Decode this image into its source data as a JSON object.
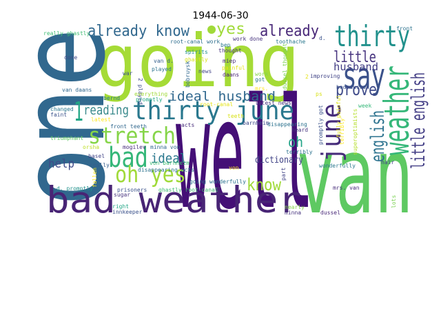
{
  "title": "1944-06-30",
  "words": [
    "going",
    "one",
    "well",
    "van",
    "bad weather",
    "thirty june",
    "thirty",
    "say",
    "weather",
    "little english",
    "english",
    "june",
    "already know",
    "yes",
    "already",
    "little",
    "husband",
    "ideal husband",
    "prove",
    "1",
    "reading",
    "stretch",
    "bad",
    "ideal",
    "oh yes",
    "help",
    "oh",
    "dictionary",
    "know",
    "really ghastly",
    "root-canal work",
    "bep",
    "thought",
    "done",
    "spirits",
    "van d.",
    "ghastly",
    "miep",
    "played",
    "war",
    "2 played",
    "bobruysk",
    "news",
    "painful",
    "daans",
    "van daans",
    "everything",
    "bernd",
    "promptly",
    "root-canal",
    "changed",
    "faint",
    "latest",
    "teeth",
    "front teeth",
    "acts",
    "work done",
    "toothache",
    "d.",
    "front",
    "dussel thought",
    "work",
    "got",
    "mrs.",
    "2",
    "improving",
    "bad dussel",
    "ps",
    "latest news",
    "week",
    "barnheim",
    "disappearing",
    "heard",
    "promptly got",
    "fully painful",
    "superoptimists",
    "triumphant",
    "orsha",
    "mogilev",
    "minna von",
    "basel",
    "really",
    "von barnheim",
    "disappearing acts",
    "fallen",
    "d. promptly",
    "prisoners",
    "ghastly root-canal",
    "going wonderfully",
    "sugar",
    "right",
    "innkeeper",
    "von",
    "terribly",
    "wonderfully",
    "hair",
    "part",
    "mrs. van",
    "nearly",
    "minna",
    "dussel",
    "lots",
    "terribly"
  ]
}
